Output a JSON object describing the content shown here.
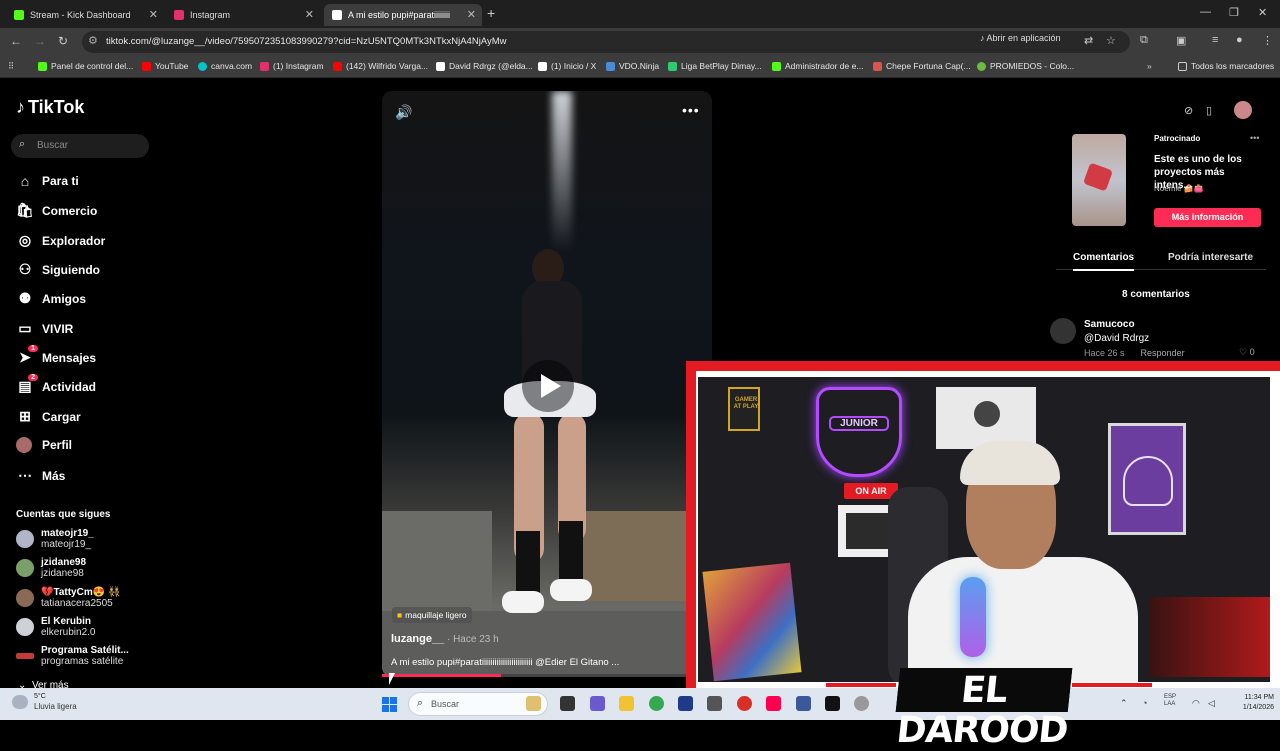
{
  "browser": {
    "tabs": [
      {
        "label": "Stream - Kick Dashboard",
        "color": "#53fc18"
      },
      {
        "label": "Instagram",
        "color": "#e1306c"
      },
      {
        "label": "A mi estilo pupi#paratiiiiiiii",
        "color": "#ffffff"
      }
    ],
    "url": "tiktok.com/@luzange__/video/7595072351083990279?cid=NzU5NTQ0MTk3NTkxNjA4NjAyMw",
    "open_in_app": "Abrir en aplicación",
    "bookmarks": [
      {
        "label": "Panel de control del...",
        "color": "#53fc18"
      },
      {
        "label": "YouTube",
        "color": "#ff0000"
      },
      {
        "label": "canva.com",
        "color": "#00c4cc"
      },
      {
        "label": "(1) Instagram",
        "color": "#e1306c"
      },
      {
        "label": "(142) Wilfrido Varga...",
        "color": "#ff0000"
      },
      {
        "label": "David Rdrgz (@elda...",
        "color": "#ffffff"
      },
      {
        "label": "(1) Inicio / X",
        "color": "#ffffff"
      },
      {
        "label": "VDO.Ninja",
        "color": "#4a8bd4"
      },
      {
        "label": "Liga BetPlay Dimay...",
        "color": "#2ecc71"
      },
      {
        "label": "Administrador de e...",
        "color": "#53fc18"
      },
      {
        "label": "Chepe Fortuna Cap(...",
        "color": "#d9534f"
      },
      {
        "label": "PROMIEDOS - Colo...",
        "color": "#6abf3a"
      }
    ],
    "all_bookmarks": "Todos los marcadores"
  },
  "sidebar": {
    "logo": "TikTok",
    "search_placeholder": "Buscar",
    "nav": [
      {
        "label": "Para ti",
        "icon": "home-icon"
      },
      {
        "label": "Comercio",
        "icon": "shop-icon"
      },
      {
        "label": "Explorador",
        "icon": "compass-icon"
      },
      {
        "label": "Siguiendo",
        "icon": "following-icon"
      },
      {
        "label": "Amigos",
        "icon": "friends-icon"
      },
      {
        "label": "VIVIR",
        "icon": "live-icon"
      },
      {
        "label": "Mensajes",
        "icon": "messages-icon",
        "badge": "1"
      },
      {
        "label": "Actividad",
        "icon": "activity-icon",
        "badge": "2"
      },
      {
        "label": "Cargar",
        "icon": "upload-icon"
      },
      {
        "label": "Perfil",
        "icon": "profile-icon"
      },
      {
        "label": "Más",
        "icon": "more-icon"
      }
    ],
    "following_heading": "Cuentas que sigues",
    "accounts": [
      {
        "name": "mateojr19_",
        "handle": "mateojr19_",
        "color": "#b0b6c8"
      },
      {
        "name": "jzidane98",
        "handle": "jzidane98",
        "color": "#7aa06a"
      },
      {
        "name": "💔TattyCm😍 👯",
        "handle": "tatianacera2505",
        "color": "#8a6a52"
      },
      {
        "name": "El Kerubin",
        "handle": "elkerubin2.0",
        "color": "#d0d0d8"
      },
      {
        "name": "Programa Satélit...",
        "handle": "programas satélite",
        "color": "#c23a3a"
      }
    ],
    "see_more": "Ver más"
  },
  "video": {
    "effect": "maquillaje ligero",
    "author": "luzange__",
    "time": " · Hace 23 h",
    "caption": "A mi estilo pupi#paratiiiiiiiiiiiiiiiiiiiiiiii @Edier El Gitano ...",
    "progress": 0.36
  },
  "right": {
    "sponsored": "Patrocinado",
    "ad_title": "Este es uno de los proyectos más intens...",
    "ad_user": "Noémie 🍰👛",
    "more_info": "Más información",
    "tab_comments": "Comentarios",
    "tab_interest": "Podría interesarte",
    "comment_count": "8 comentarios",
    "comment": {
      "user": "Samucoco",
      "text": "@David Rdrgz",
      "time": "Hace 26 s",
      "reply": "Responder",
      "likes": "0"
    }
  },
  "webcam": {
    "shield_text": "JUNIOR",
    "on_air": "ON AIR",
    "poster": "GAMER AT PLAY",
    "overlay_name": "EL DAROOD"
  },
  "taskbar": {
    "temp": "5°C",
    "weather": "Lluvia ligera",
    "search_placeholder": "Buscar",
    "lang": "ESP",
    "lang2": "LAA",
    "time": "11:34 PM",
    "date": "1/14/2026",
    "app_colors": [
      "#e0c070",
      "#333333",
      "#6a5acd",
      "#f1c232",
      "#34a853",
      "#1f3a8a",
      "#555555",
      "#d93025",
      "#ff0050",
      "#3b5998",
      "#111111",
      "#999999"
    ]
  }
}
